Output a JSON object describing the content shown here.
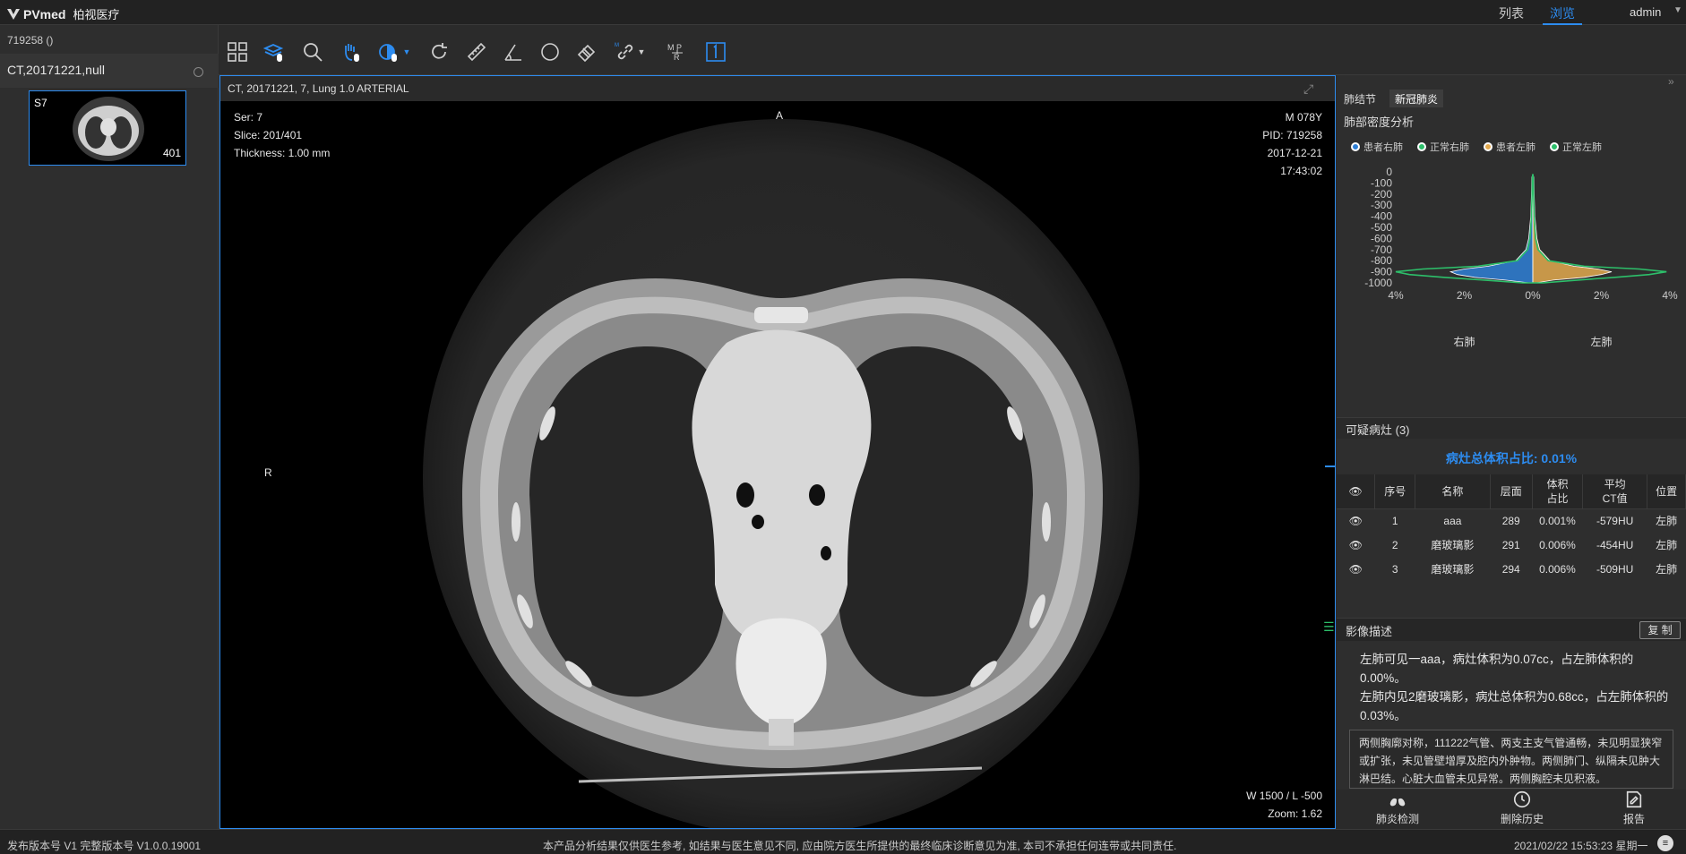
{
  "app": {
    "brand": "PVmed",
    "brand_sub": "柏视医疗"
  },
  "nav": {
    "list": "列表",
    "browse": "浏览",
    "user": "admin"
  },
  "left": {
    "patient_id": "719258 ()",
    "study": "CT,20171221,null",
    "thumb_series": "S7",
    "thumb_count": "401"
  },
  "toolbar": {
    "icons": [
      "layout-grid-icon",
      "stack-scroll-icon",
      "zoom-icon",
      "pan-icon",
      "window-level-icon",
      "rotate-icon",
      "ruler-icon",
      "angle-icon",
      "ellipse-roi-icon",
      "eraser-icon",
      "link-icon",
      "mpr-icon",
      "single-view-icon"
    ],
    "accent": "#2d8cf0"
  },
  "viewer": {
    "title": "CT, 20171221, 7, Lung 1.0 ARTERIAL",
    "ser": "Ser: 7",
    "slice": "Slice: 201/401",
    "thickness": "Thickness: 1.00 mm",
    "sex_age": "M 078Y",
    "pid": "PID: 719258",
    "date": "2017-12-21",
    "time": "17:43:02",
    "orient_top": "A",
    "orient_left": "R",
    "wl": "W 1500 / L -500",
    "zoom": "Zoom: 1.62"
  },
  "right": {
    "tabs": [
      "肺结节",
      "新冠肺炎"
    ],
    "density_title": "肺部密度分析",
    "legend": [
      {
        "label": "患者右肺",
        "color": "#2e7fd6"
      },
      {
        "label": "正常右肺",
        "color": "#2dbf6a"
      },
      {
        "label": "患者左肺",
        "color": "#e2a94e"
      },
      {
        "label": "正常左肺",
        "color": "#2dbf6a"
      }
    ],
    "lesion_title": "可疑病灶 (3)",
    "ratio": "病灶总体积占比: 0.01%",
    "table": {
      "headers": [
        "序号",
        "名称",
        "层面",
        "体积占比",
        "平均CT值",
        "位置"
      ],
      "header_lines": [
        [
          "序号"
        ],
        [
          "名称"
        ],
        [
          "层面"
        ],
        [
          "体积",
          "占比"
        ],
        [
          "平均",
          "CT值"
        ],
        [
          "位置"
        ]
      ],
      "rows": [
        [
          "1",
          "aaa",
          "289",
          "0.001%",
          "-579HU",
          "左肺"
        ],
        [
          "2",
          "磨玻璃影",
          "291",
          "0.006%",
          "-454HU",
          "左肺"
        ],
        [
          "3",
          "磨玻璃影",
          "294",
          "0.006%",
          "-509HU",
          "左肺"
        ]
      ]
    },
    "desc_title": "影像描述",
    "copy": "复 制",
    "desc_auto_1": "左肺可见一aaa，病灶体积为0.07cc，占左肺体积的0.00%。",
    "desc_auto_2": "左肺内见2磨玻璃影，病灶总体积为0.68cc，占左肺体积的0.03%。",
    "desc_text": "两侧胸廓对称，111222气管、两支主支气管通畅，未见明显狭窄或扩张，未见管壁增厚及腔内外肿物。两侧肺门、纵隔未见肿大淋巴结。心脏大血管未见异常。两侧胸腔未见积液。",
    "actions": [
      "肺炎检测",
      "删除历史",
      "报告"
    ]
  },
  "chart_data": {
    "type": "area",
    "title": "",
    "xlabel": "",
    "ylabel": "",
    "y_ticks": [
      0,
      -100,
      -200,
      -300,
      -400,
      -500,
      -600,
      -700,
      -800,
      -900,
      -1000
    ],
    "x_ticks": [
      "4%",
      "2%",
      "0%",
      "2%",
      "4%"
    ],
    "side_labels": [
      "右肺",
      "左肺"
    ],
    "ylim": [
      -1000,
      0
    ],
    "xlim_percent": [
      4,
      4
    ],
    "y": [
      -1000,
      -975,
      -950,
      -925,
      -900,
      -875,
      -850,
      -800,
      -700,
      -600,
      -400,
      -200,
      -50,
      -20
    ],
    "series": [
      {
        "name": "患者右肺",
        "side": "left",
        "color": "#2e7fd6",
        "values": [
          0.1,
          0.8,
          1.7,
          2.2,
          2.4,
          2.0,
          1.3,
          0.5,
          0.2,
          0.12,
          0.06,
          0.04,
          0.03,
          0.0
        ]
      },
      {
        "name": "患者左肺",
        "side": "right",
        "color": "#e2a94e",
        "values": [
          0.1,
          0.6,
          1.5,
          2.0,
          2.3,
          1.9,
          1.2,
          0.5,
          0.2,
          0.12,
          0.06,
          0.04,
          0.03,
          0.0
        ]
      },
      {
        "name": "正常右肺",
        "side": "left",
        "color": "#2dbf6a",
        "values": [
          0.3,
          1.4,
          2.6,
          3.6,
          4.0,
          3.2,
          1.6,
          0.45,
          0.15,
          0.08,
          0.04,
          0.02,
          0.01,
          0.0
        ]
      },
      {
        "name": "正常左肺",
        "side": "right",
        "color": "#2dbf6a",
        "values": [
          0.3,
          1.3,
          2.4,
          3.4,
          3.9,
          3.1,
          1.5,
          0.45,
          0.15,
          0.08,
          0.04,
          0.02,
          0.01,
          0.0
        ]
      }
    ]
  },
  "footer": {
    "version": "发布版本号 V1 完整版本号 V1.0.0.19001",
    "disclaimer": "本产品分析结果仅供医生参考, 如结果与医生意见不同, 应由院方医生所提供的最终临床诊断意见为准, 本司不承担任何连带或共同责任.",
    "datetime": "2021/02/22 15:53:23 星期一"
  }
}
